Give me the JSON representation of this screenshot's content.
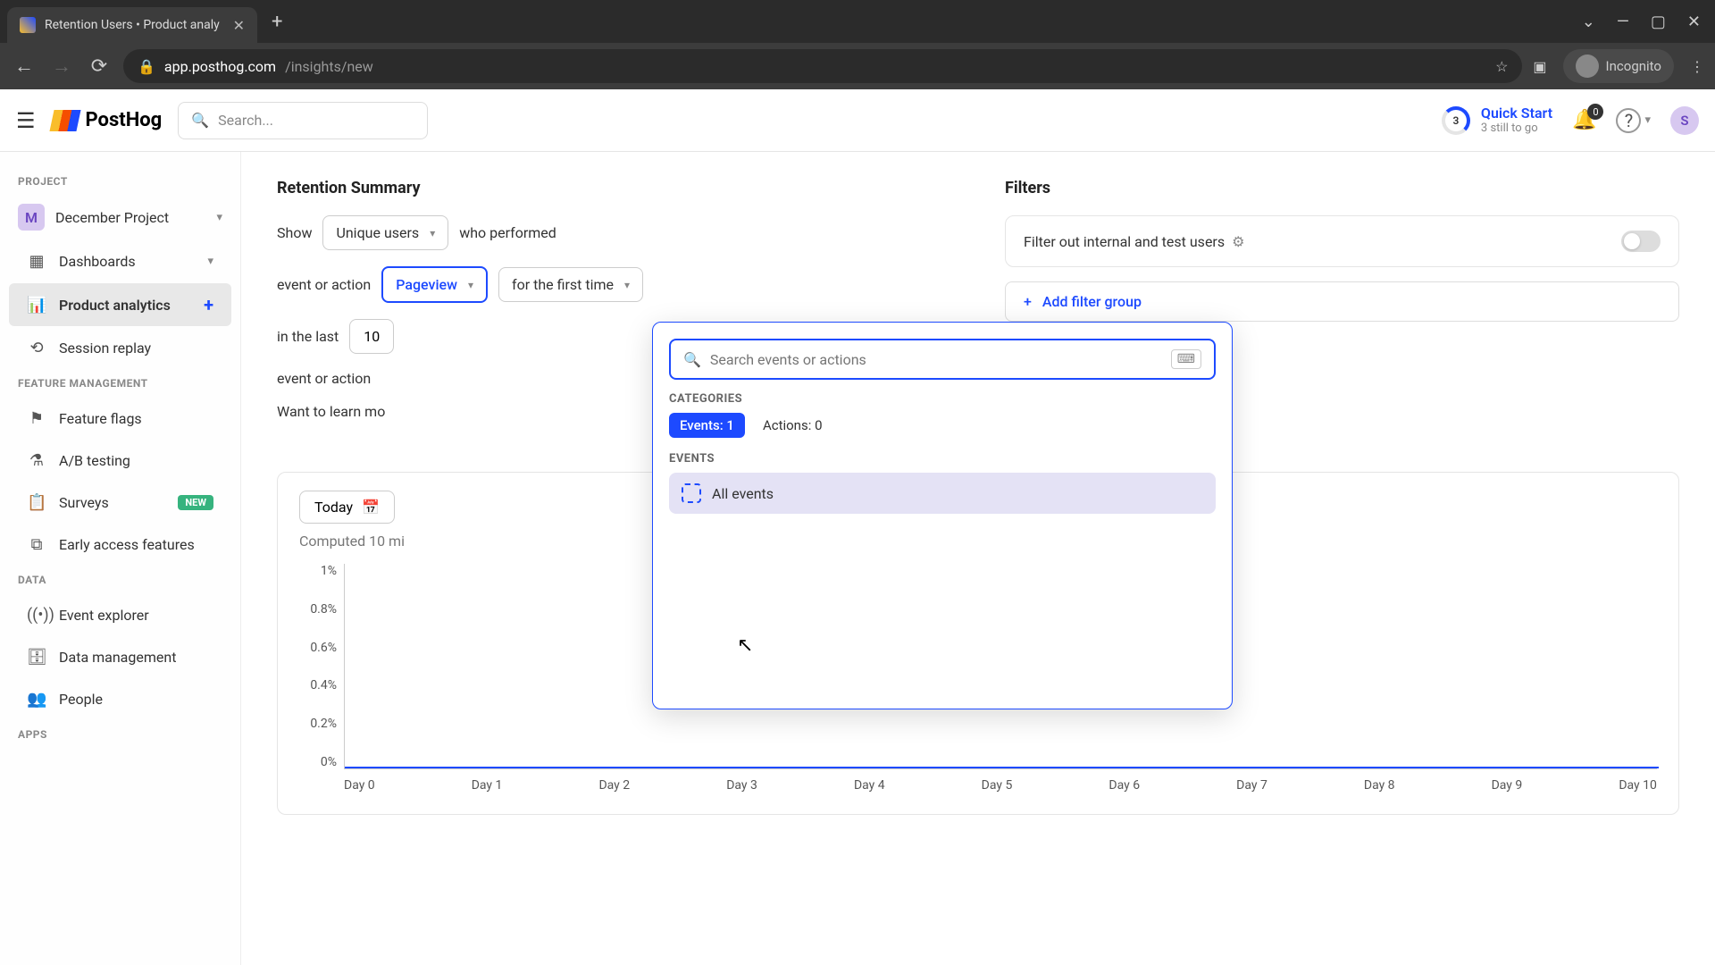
{
  "browser": {
    "tab_title": "Retention Users • Product analy",
    "url_domain": "app.posthog.com",
    "url_path": "/insights/new",
    "incognito_label": "Incognito"
  },
  "topbar": {
    "logo_text": "PostHog",
    "search_placeholder": "Search...",
    "quick_start": {
      "badge": "3",
      "title": "Quick Start",
      "subtitle": "3 still to go"
    },
    "bell_count": "0",
    "user_initial": "S"
  },
  "sidebar": {
    "sections": {
      "project": "PROJECT",
      "feature_mgmt": "FEATURE MANAGEMENT",
      "data": "DATA",
      "apps": "APPS"
    },
    "project": {
      "initial": "M",
      "name": "December Project"
    },
    "items": {
      "dashboards": "Dashboards",
      "product_analytics": "Product analytics",
      "session_replay": "Session replay",
      "feature_flags": "Feature flags",
      "ab_testing": "A/B testing",
      "surveys": "Surveys",
      "early_access": "Early access features",
      "event_explorer": "Event explorer",
      "data_management": "Data management",
      "people": "People"
    },
    "new_badge": "NEW"
  },
  "main": {
    "retention_title": "Retention Summary",
    "filters_title": "Filters",
    "show_label": "Show",
    "unique_users": "Unique users",
    "who_performed": "who performed",
    "event_or_action": "event or action",
    "pageview": "Pageview",
    "for_first_time": "for the first time",
    "in_last": "in the last",
    "in_last_value": "10",
    "learn_more": "Want to learn mo",
    "filter_internal": "Filter out internal and test users",
    "add_filter_group": "Add filter group"
  },
  "dropdown": {
    "search_placeholder": "Search events or actions",
    "categories_label": "CATEGORIES",
    "events_chip": "Events: 1",
    "actions_chip": "Actions: 0",
    "events_label": "EVENTS",
    "all_events": "All events"
  },
  "chart": {
    "today": "Today",
    "computed": "Computed 10 mi"
  },
  "chart_data": {
    "type": "line",
    "title": "",
    "xlabel": "",
    "ylabel": "",
    "ylim": [
      0,
      1
    ],
    "y_ticks": [
      "1%",
      "0.8%",
      "0.6%",
      "0.4%",
      "0.2%",
      "0%"
    ],
    "categories": [
      "Day 0",
      "Day 1",
      "Day 2",
      "Day 3",
      "Day 4",
      "Day 5",
      "Day 6",
      "Day 7",
      "Day 8",
      "Day 9",
      "Day 10"
    ],
    "values": [
      0,
      0,
      0,
      0,
      0,
      0,
      0,
      0,
      0,
      0,
      0
    ]
  }
}
